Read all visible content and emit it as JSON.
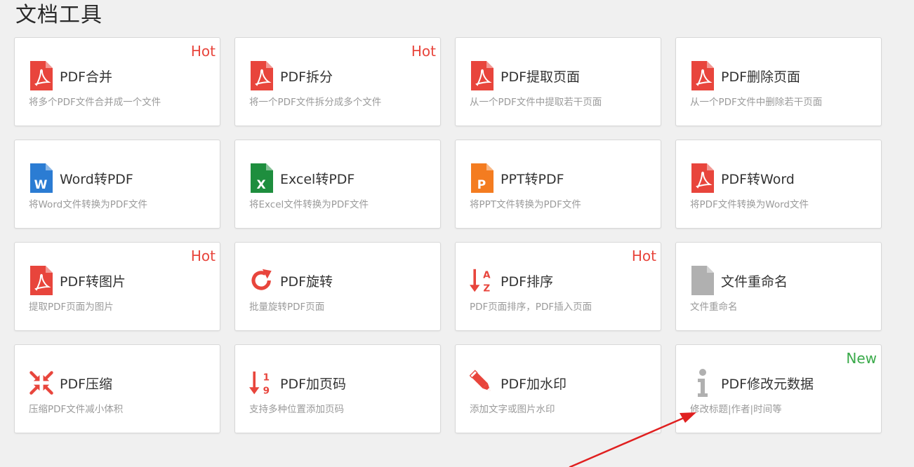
{
  "page": {
    "title": "文档工具"
  },
  "colors": {
    "hot": "#e8453c",
    "new": "#3aaa4a",
    "pdf": "#e8453c",
    "word": "#2b7cd3",
    "excel": "#1e8e3e",
    "ppt": "#f47c20",
    "gray": "#b0b0b0",
    "arrow": "#e02020"
  },
  "badges": {
    "hot": "Hot",
    "new": "New"
  },
  "tools": [
    {
      "title": "PDF合并",
      "desc": "将多个PDF文件合并成一个文件",
      "icon": "pdf-file-icon",
      "badge": "Hot"
    },
    {
      "title": "PDF拆分",
      "desc": "将一个PDF文件拆分成多个文件",
      "icon": "pdf-file-icon",
      "badge": "Hot"
    },
    {
      "title": "PDF提取页面",
      "desc": "从一个PDF文件中提取若干页面",
      "icon": "pdf-file-icon",
      "badge": ""
    },
    {
      "title": "PDF删除页面",
      "desc": "从一个PDF文件中删除若干页面",
      "icon": "pdf-file-icon",
      "badge": ""
    },
    {
      "title": "Word转PDF",
      "desc": "将Word文件转换为PDF文件",
      "icon": "word-file-icon",
      "badge": ""
    },
    {
      "title": "Excel转PDF",
      "desc": "将Excel文件转换为PDF文件",
      "icon": "excel-file-icon",
      "badge": ""
    },
    {
      "title": "PPT转PDF",
      "desc": "将PPT文件转换为PDF文件",
      "icon": "ppt-file-icon",
      "badge": ""
    },
    {
      "title": "PDF转Word",
      "desc": "将PDF文件转换为Word文件",
      "icon": "pdf-file-icon",
      "badge": ""
    },
    {
      "title": "PDF转图片",
      "desc": "提取PDF页面为图片",
      "icon": "pdf-file-icon",
      "badge": "Hot"
    },
    {
      "title": "PDF旋转",
      "desc": "批量旋转PDF页面",
      "icon": "rotate-icon",
      "badge": ""
    },
    {
      "title": "PDF排序",
      "desc": "PDF页面排序，PDF插入页面",
      "icon": "sort-az-icon",
      "badge": "Hot"
    },
    {
      "title": "文件重命名",
      "desc": "文件重命名",
      "icon": "blank-file-icon",
      "badge": ""
    },
    {
      "title": "PDF压缩",
      "desc": "压缩PDF文件减小体积",
      "icon": "compress-icon",
      "badge": ""
    },
    {
      "title": "PDF加页码",
      "desc": "支持多种位置添加页码",
      "icon": "page-number-icon",
      "badge": ""
    },
    {
      "title": "PDF加水印",
      "desc": "添加文字或图片水印",
      "icon": "pencil-icon",
      "badge": ""
    },
    {
      "title": "PDF修改元数据",
      "desc": "修改标题|作者|时间等",
      "icon": "info-icon",
      "badge": "New"
    }
  ]
}
